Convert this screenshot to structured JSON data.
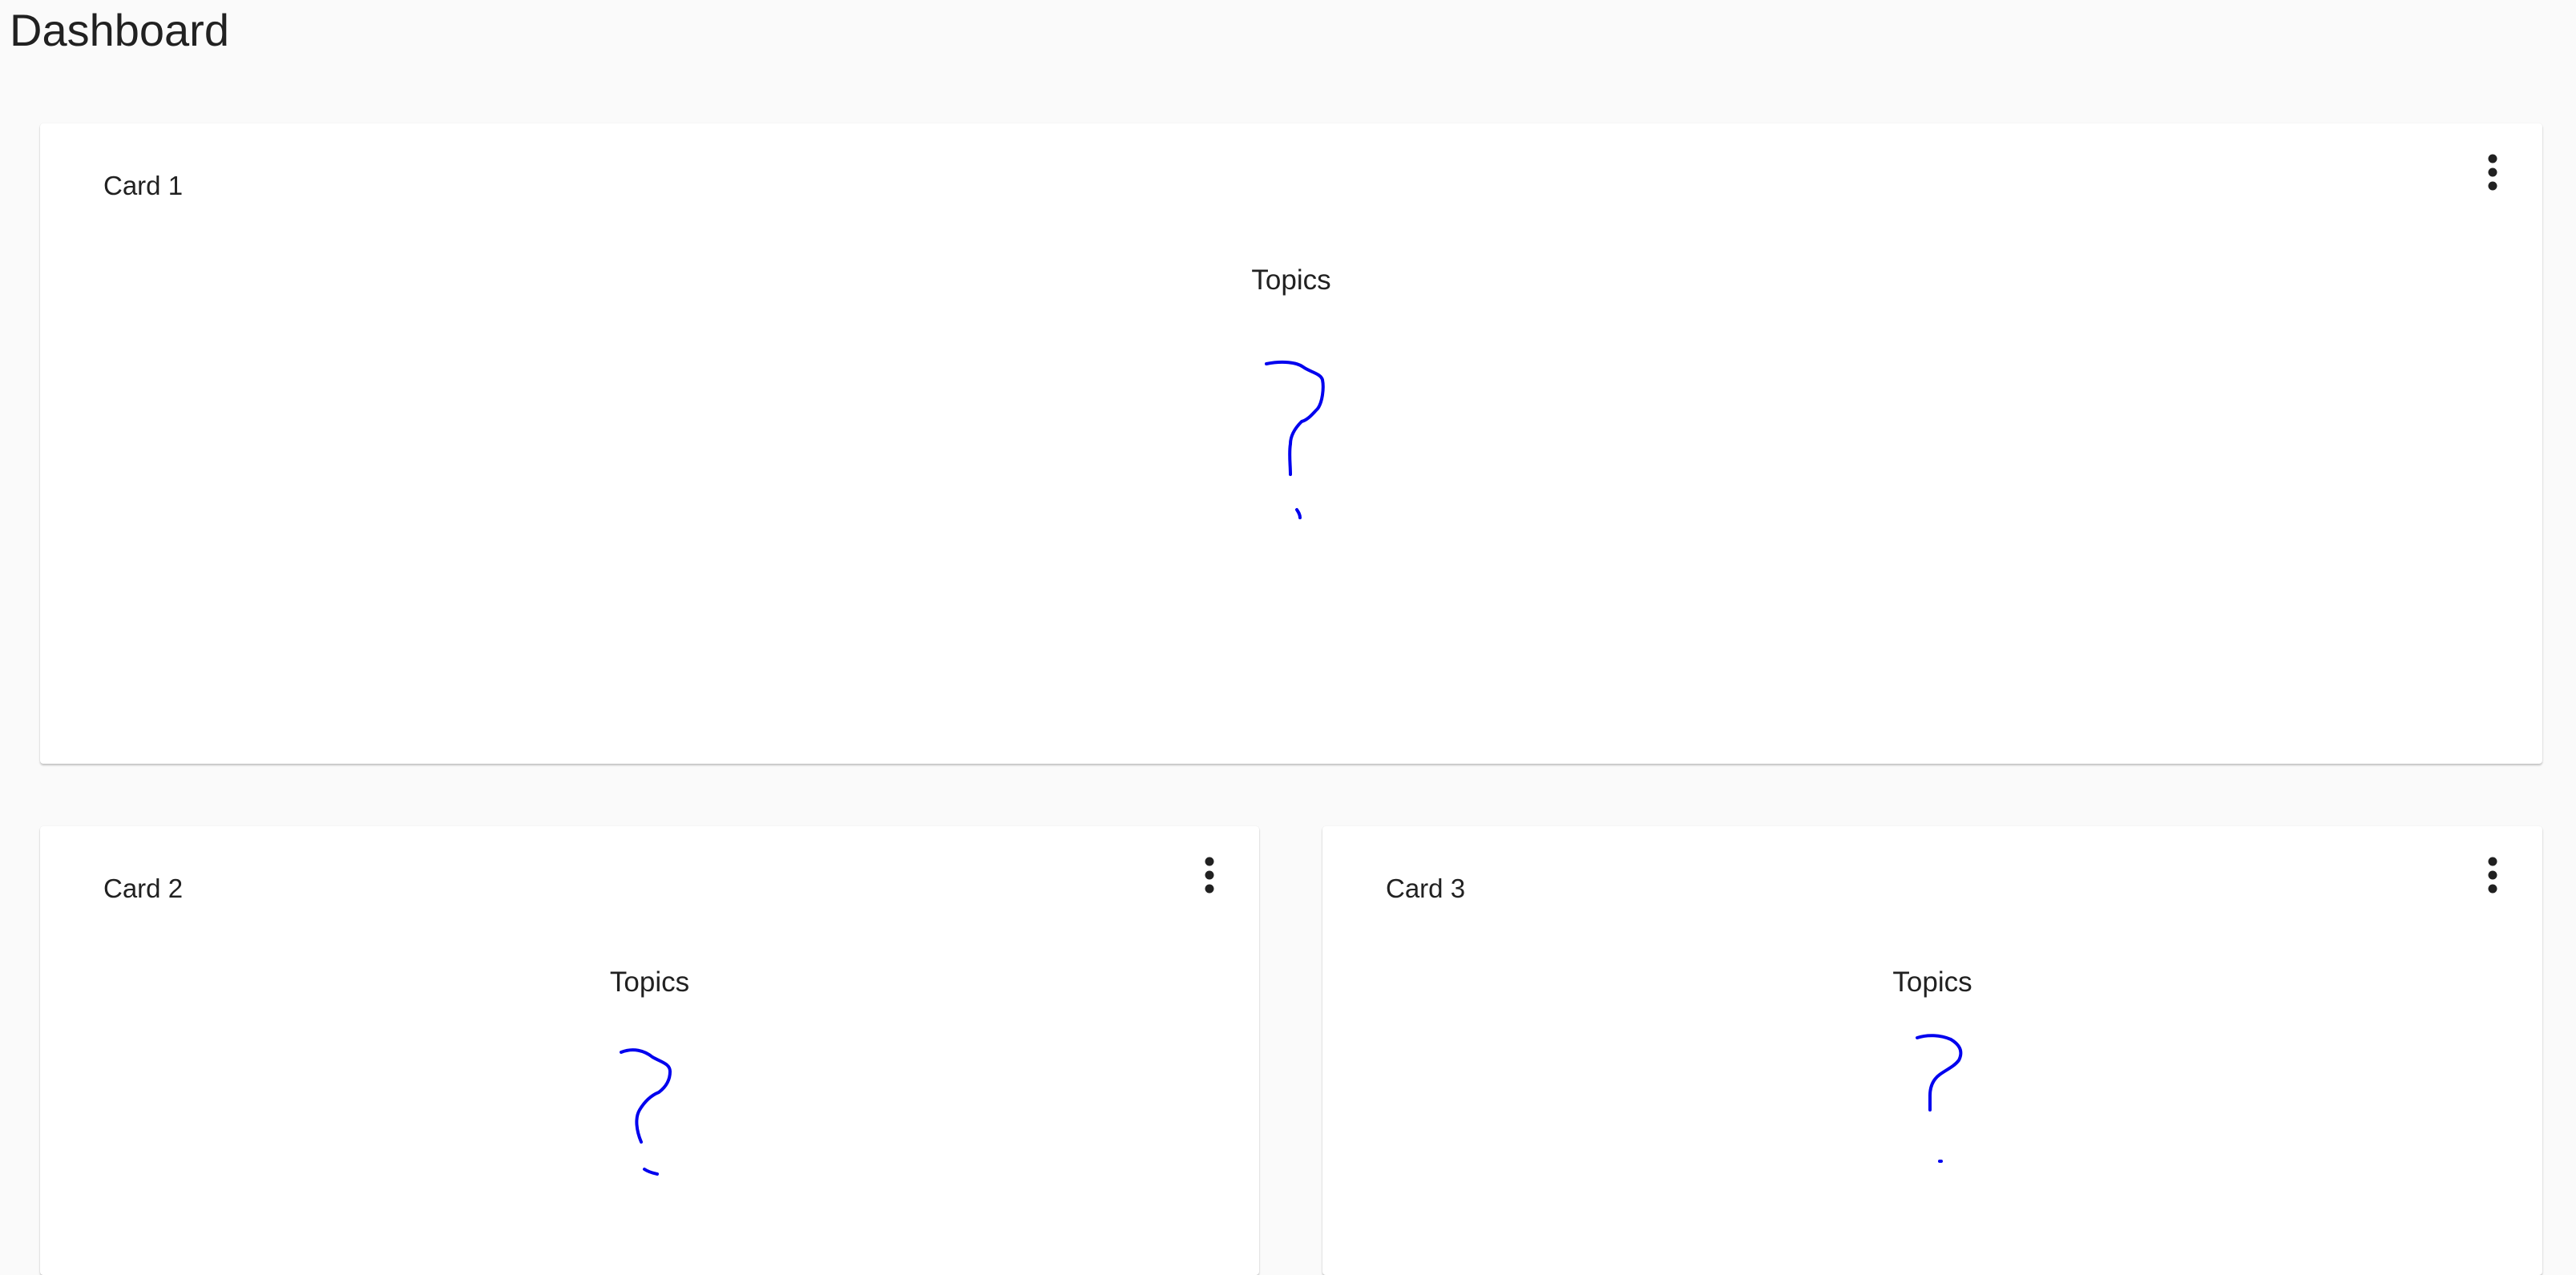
{
  "page": {
    "title": "Dashboard"
  },
  "cards": [
    {
      "title": "Card 1",
      "chart_title": "Topics",
      "menu_icon": "more-vert-icon",
      "placeholder_icon": "question-mark-icon"
    },
    {
      "title": "Card 2",
      "chart_title": "Topics",
      "menu_icon": "more-vert-icon",
      "placeholder_icon": "question-mark-icon"
    },
    {
      "title": "Card 3",
      "chart_title": "Topics",
      "menu_icon": "more-vert-icon",
      "placeholder_icon": "question-mark-icon"
    }
  ],
  "colors": {
    "background": "#fafafa",
    "card": "#ffffff",
    "text": "#212121",
    "placeholder_stroke": "#0000ee"
  }
}
